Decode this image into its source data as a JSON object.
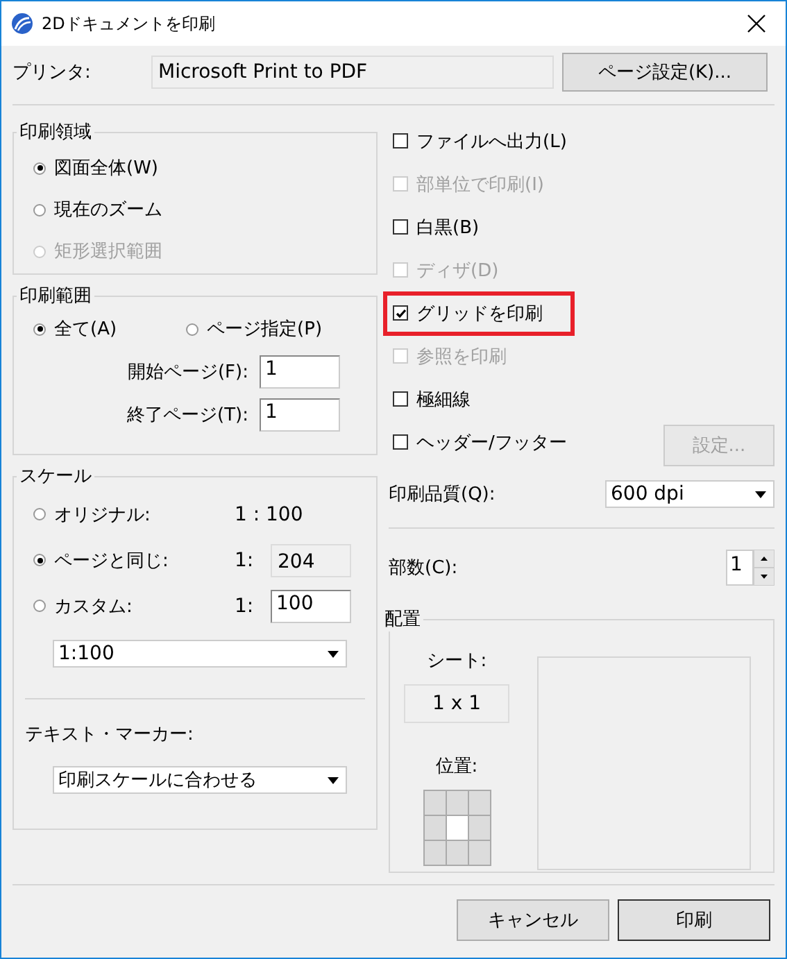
{
  "window": {
    "title": "2Dドキュメントを印刷"
  },
  "printer": {
    "label": "プリンタ:",
    "value": "Microsoft Print to PDF",
    "button": "ページ設定(K)..."
  },
  "print_area": {
    "title": "印刷領域",
    "options": [
      {
        "label": "図面全体(W)",
        "selected": true,
        "disabled": false
      },
      {
        "label": "現在のズーム",
        "selected": false,
        "disabled": false
      },
      {
        "label": "矩形選択範囲",
        "selected": false,
        "disabled": true
      }
    ]
  },
  "print_range": {
    "title": "印刷範囲",
    "options": [
      {
        "label": "全て(A)",
        "selected": true
      },
      {
        "label": "ページ指定(P)",
        "selected": false
      }
    ],
    "fields": [
      {
        "label": "開始ページ(F):",
        "value": "1"
      },
      {
        "label": "終了ページ(T):",
        "value": "1"
      }
    ]
  },
  "scale": {
    "title": "スケール",
    "options": [
      {
        "label": "オリジナル:",
        "selected": false,
        "kind": "text",
        "ratio": "1 : 100"
      },
      {
        "label": "ページと同じ:",
        "selected": true,
        "kind": "readonly",
        "ratio": "1:",
        "value": "204"
      },
      {
        "label": "カスタム:",
        "selected": false,
        "kind": "input",
        "ratio": "1:",
        "value": "100"
      }
    ],
    "preset": "1:100",
    "marker_label": "テキスト・マーカー:",
    "marker_value": "印刷スケールに合わせる"
  },
  "options": [
    {
      "label": "ファイルへ出力(L)",
      "checked": false,
      "disabled": false,
      "highlighted": false
    },
    {
      "label": "部単位で印刷(I)",
      "checked": false,
      "disabled": true,
      "highlighted": false
    },
    {
      "label": "白黒(B)",
      "checked": false,
      "disabled": false,
      "highlighted": false
    },
    {
      "label": "ディザ(D)",
      "checked": false,
      "disabled": true,
      "highlighted": false
    },
    {
      "label": "グリッドを印刷",
      "checked": true,
      "disabled": false,
      "highlighted": true
    },
    {
      "label": "参照を印刷",
      "checked": false,
      "disabled": true,
      "highlighted": false
    },
    {
      "label": "極細線",
      "checked": false,
      "disabled": false,
      "highlighted": false
    },
    {
      "label": "ヘッダー/フッター",
      "checked": false,
      "disabled": false,
      "highlighted": false,
      "button": {
        "label": "設定...",
        "disabled": true
      }
    }
  ],
  "quality": {
    "label": "印刷品質(Q):",
    "value": "600 dpi"
  },
  "copies": {
    "label": "部数(C):",
    "value": "1"
  },
  "layout": {
    "title": "配置",
    "sheet_label": "シート:",
    "sheet_value": "1 x 1",
    "position_label": "位置:",
    "positions": [
      {
        "selected": false
      },
      {
        "selected": false
      },
      {
        "selected": false
      },
      {
        "selected": false
      },
      {
        "selected": true
      },
      {
        "selected": false
      },
      {
        "selected": false
      },
      {
        "selected": false
      },
      {
        "selected": false
      }
    ]
  },
  "buttons": [
    {
      "label": "キャンセル",
      "default": false
    },
    {
      "label": "印刷",
      "default": true
    }
  ]
}
